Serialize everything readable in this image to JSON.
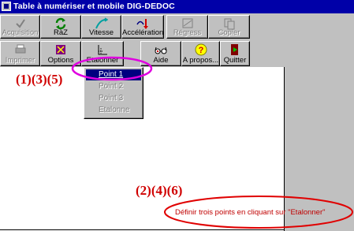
{
  "window": {
    "title": "Table à numériser et mobile DIG-DEDOC"
  },
  "toolbar_row1": [
    {
      "id": "acquisition",
      "label": "Acquisition",
      "icon": "checkmark-icon",
      "enabled": false
    },
    {
      "id": "raz",
      "label": "RàZ",
      "icon": "refresh-icon",
      "enabled": true
    },
    {
      "id": "vitesse",
      "label": "Vitesse",
      "icon": "speed-curve-icon",
      "enabled": true
    },
    {
      "id": "acceleration",
      "label": "Accélération",
      "icon": "acceleration-arrow-icon",
      "enabled": true
    },
    {
      "id": "regress",
      "label": "Régress",
      "icon": "regression-icon",
      "enabled": false
    },
    {
      "id": "copier",
      "label": "Copier",
      "icon": "copy-icon",
      "enabled": false
    }
  ],
  "toolbar_row2": [
    {
      "id": "imprimer",
      "label": "Imprimer",
      "icon": "printer-icon",
      "enabled": false
    },
    {
      "id": "options",
      "label": "Options",
      "icon": "options-icon",
      "enabled": true
    },
    {
      "id": "etalonner",
      "label": "Etalonner",
      "icon": "calibrate-icon",
      "enabled": true
    },
    {
      "id": "aide",
      "label": "Aide",
      "icon": "glasses-icon",
      "enabled": true
    },
    {
      "id": "apropos",
      "label": "A propos...",
      "icon": "question-icon",
      "enabled": true
    },
    {
      "id": "quitter",
      "label": "Quitter",
      "icon": "exit-door-icon",
      "enabled": true
    }
  ],
  "etalonner_menu": {
    "items": [
      {
        "label": "Point 1",
        "enabled": true,
        "selected": true
      },
      {
        "label": "Point 2",
        "enabled": false,
        "selected": false
      },
      {
        "label": "Point 3",
        "enabled": false,
        "selected": false
      },
      {
        "label": "Etalonne",
        "enabled": false,
        "selected": false
      }
    ]
  },
  "annotations": {
    "steps_menu": "(1)(3)(5)",
    "steps_click": "(2)(4)(6)"
  },
  "status_message": "Définir trois points en cliquant sur \"Etalonner\"",
  "colors": {
    "titlebar": "#0000a8",
    "annotation": "#d00000",
    "highlight_ring": "#e000e0",
    "face": "#c0c0c0"
  }
}
